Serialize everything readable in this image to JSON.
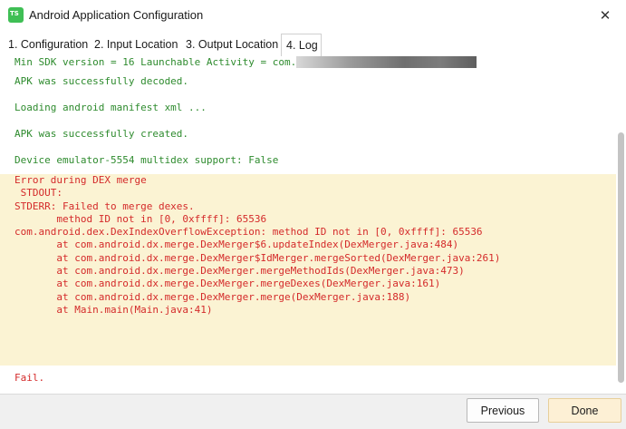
{
  "window": {
    "title": "Android Application Configuration",
    "icon": "app-icon",
    "close_glyph": "✕"
  },
  "tabs": [
    {
      "label": "1. Configuration",
      "active": false
    },
    {
      "label": "2. Input Location",
      "active": false
    },
    {
      "label": "3. Output Location",
      "active": false
    },
    {
      "label": "4. Log",
      "active": true
    }
  ],
  "log": {
    "success_color": "#2e8b2e",
    "error_color": "#d42a2a",
    "error_background": "#fbf3d3",
    "lines": [
      "Min SDK version = 16 Launchable Activity = com.",
      "APK was successfully decoded.",
      "Loading android manifest xml ...",
      "APK was successfully created.",
      "Device emulator-5554 multidex support: False"
    ],
    "error": "Error during DEX merge\n STDOUT:\nSTDERR: Failed to merge dexes.\n       method ID not in [0, 0xffff]: 65536\ncom.android.dex.DexIndexOverflowException: method ID not in [0, 0xffff]: 65536\n       at com.android.dx.merge.DexMerger$6.updateIndex(DexMerger.java:484)\n       at com.android.dx.merge.DexMerger$IdMerger.mergeSorted(DexMerger.java:261)\n       at com.android.dx.merge.DexMerger.mergeMethodIds(DexMerger.java:473)\n       at com.android.dx.merge.DexMerger.mergeDexes(DexMerger.java:161)\n       at com.android.dx.merge.DexMerger.merge(DexMerger.java:188)\n       at Main.main(Main.java:41)",
    "fail": "Fail."
  },
  "footer": {
    "previous_label": "Previous",
    "done_label": "Done"
  }
}
